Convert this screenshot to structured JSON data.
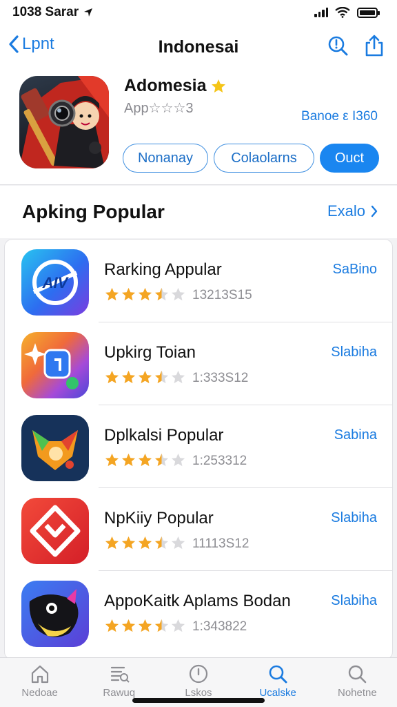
{
  "status_bar": {
    "time": "1038 Sarar"
  },
  "nav": {
    "back_label": "Lpnt",
    "title": "Indonesai"
  },
  "app": {
    "name": "Adomesia",
    "subtitle": "Aрр☆☆☆3",
    "meta": "Banoe ε I360",
    "buttons": [
      "Nonanay",
      "Colaolarns",
      "Ouct"
    ]
  },
  "section": {
    "title": "Apking Popular",
    "link": "Exalo"
  },
  "apps": [
    {
      "title": "Rarking Appular",
      "count": "13213S15",
      "action": "SaBino",
      "rating": 3.5,
      "icon": "compass-app-icon"
    },
    {
      "title": "Upkirg Toian",
      "count": "1:333S12",
      "action": "Slabiha",
      "rating": 3.5,
      "icon": "sparkle-app-icon"
    },
    {
      "title": "Dplkalsi Popular",
      "count": "1:253312",
      "action": "Sabina",
      "rating": 3.5,
      "icon": "fox-app-icon"
    },
    {
      "title": "NpKiiy Popular",
      "count": "11113S12",
      "action": "Slabiha",
      "rating": 3.5,
      "icon": "diamond-app-icon"
    },
    {
      "title": "AppoKaitk Aplams Bodan",
      "count": "1:343822",
      "action": "Slabiha",
      "rating": 3.5,
      "icon": "orca-app-icon"
    }
  ],
  "tabs": [
    {
      "label": "Nedoae",
      "icon": "home-icon"
    },
    {
      "label": "Rawuq",
      "icon": "list-icon"
    },
    {
      "label": "Lskos",
      "icon": "clock-icon"
    },
    {
      "label": "Ucalske",
      "icon": "search-icon",
      "active": true
    },
    {
      "label": "Nohetne",
      "icon": "search-icon"
    }
  ],
  "colors": {
    "accent": "#1a7be0",
    "star": "#f4a523"
  }
}
